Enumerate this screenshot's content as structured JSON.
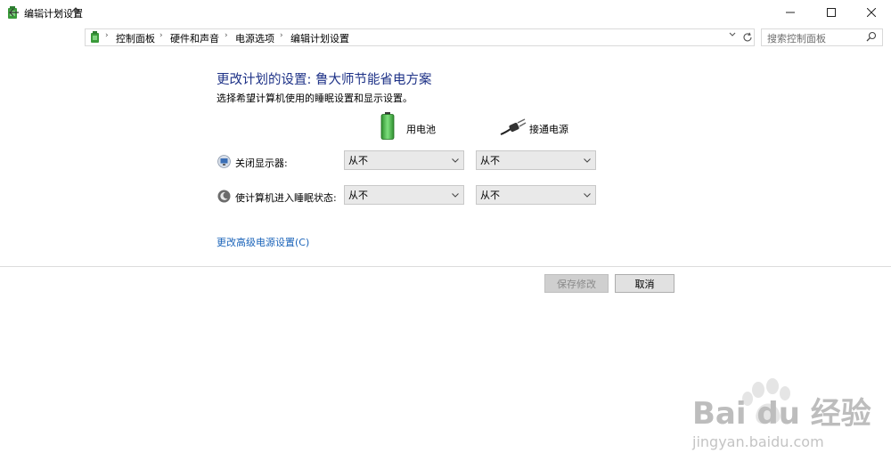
{
  "window": {
    "title": "编辑计划设置"
  },
  "nav": {
    "breadcrumbs": [
      "控制面板",
      "硬件和声音",
      "电源选项",
      "编辑计划设置"
    ],
    "search_placeholder": "搜索控制面板"
  },
  "main": {
    "title": "更改计划的设置: 鲁大师节能省电方案",
    "subtitle": "选择希望计算机使用的睡眠设置和显示设置。",
    "col_battery": "用电池",
    "col_plugged": "接通电源",
    "rows": [
      {
        "label": "关闭显示器:",
        "battery_value": "从不",
        "plugged_value": "从不"
      },
      {
        "label": "使计算机进入睡眠状态:",
        "battery_value": "从不",
        "plugged_value": "从不"
      }
    ],
    "advanced_link": "更改高级电源设置(C)"
  },
  "buttons": {
    "save": "保存修改",
    "cancel": "取消"
  },
  "watermark": {
    "main": "Bai du 经验",
    "sub": "jingyan.baidu.com"
  },
  "colors": {
    "title": "#1e3287",
    "link": "#1a63b9"
  },
  "icons": [
    "back-arrow-icon",
    "forward-arrow-icon",
    "recent-chevron-icon",
    "up-arrow-icon",
    "control-panel-icon",
    "refresh-icon",
    "search-icon",
    "battery-icon",
    "plug-icon",
    "display-icon",
    "sleep-moon-icon",
    "minimize-icon",
    "maximize-icon",
    "close-icon"
  ]
}
